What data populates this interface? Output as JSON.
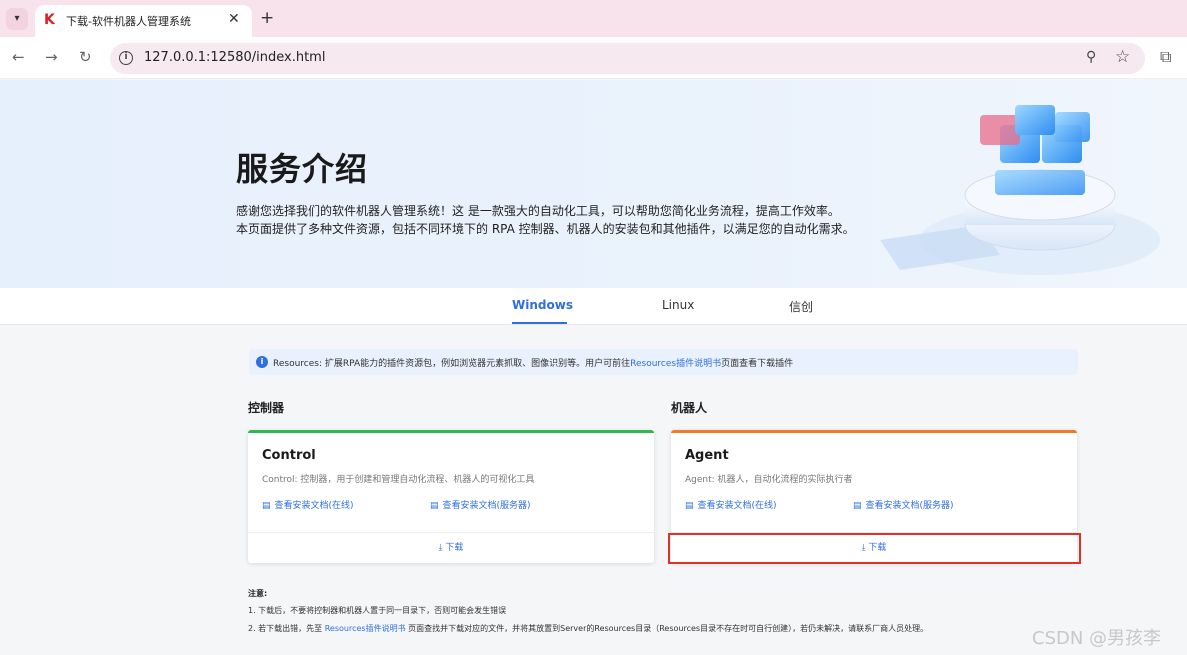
{
  "browser": {
    "tab_title": "下载-软件机器人管理系统",
    "tab_favicon": "K",
    "new_tab_label": "+",
    "close_label": "✕",
    "url": "127.0.0.1:12580/index.html"
  },
  "hero": {
    "title": "服务介绍",
    "desc_line1": "感谢您选择我们的软件机器人管理系统！这 是一款强大的自动化工具，可以帮助您简化业务流程，提高工作效率。",
    "desc_line2": "本页面提供了多种文件资源，包括不同环境下的 RPA 控制器、机器人的安装包和其他插件，以满足您的自动化需求。"
  },
  "os_tabs": [
    "Windows",
    "Linux",
    "信创"
  ],
  "notice": {
    "prefix": "Resources: 扩展RPA能力的插件资源包，例如浏览器元素抓取、图像识别等。用户可前往",
    "link": "Resources插件说明书",
    "suffix": "页面查看下载插件"
  },
  "sections": {
    "control_title": "控制器",
    "agent_title": "机器人"
  },
  "cards": {
    "control": {
      "name": "Control",
      "desc": "Control: 控制器，用于创建和管理自动化流程、机器人的可视化工具",
      "doc_online": "查看安装文档(在线)",
      "doc_server": "查看安装文档(服务器)",
      "download": "下载"
    },
    "agent": {
      "name": "Agent",
      "desc": "Agent: 机器人，自动化流程的实际执行者",
      "doc_online": "查看安装文档(在线)",
      "doc_server": "查看安装文档(服务器)",
      "download": "下载"
    }
  },
  "notes": {
    "title": "注意:",
    "line1": "1. 下载后，不要将控制器和机器人置于同一目录下，否则可能会发生错误",
    "line2_prefix": "2. 若下载出错，先至",
    "line2_link": "Resources插件说明书",
    "line2_suffix": "页面查找并下载对应的文件，并将其放置到Server的Resources目录（Resources目录不存在时可自行创建），若仍未解决，请联系厂商人员处理。"
  },
  "watermark": "CSDN @男孩李",
  "colors": {
    "accent": "#2f6fe0",
    "control_bar": "#2fb84f",
    "agent_bar": "#f07a28",
    "highlight": "#e0302a"
  }
}
